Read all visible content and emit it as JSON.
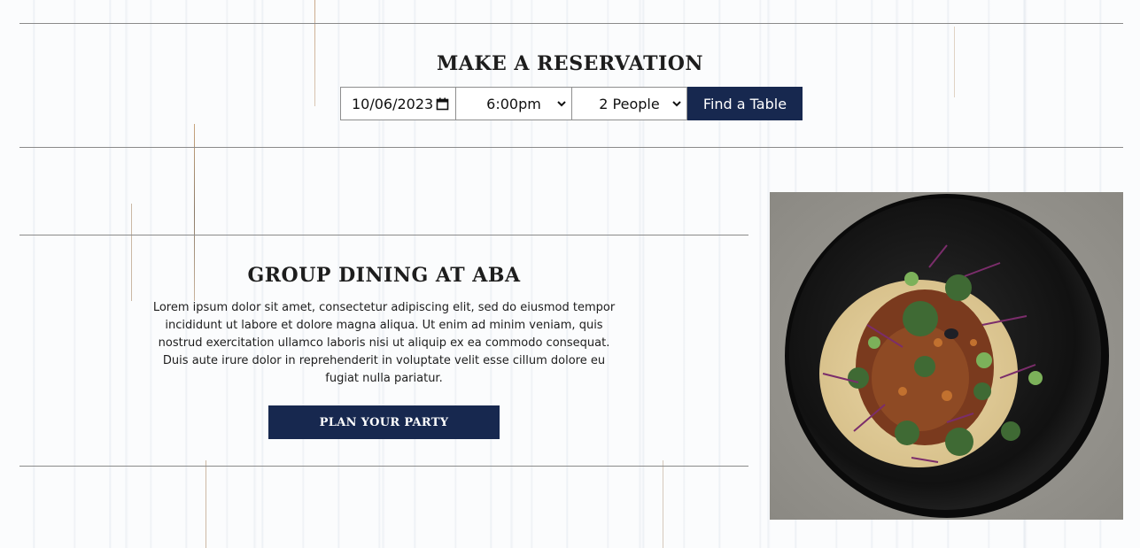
{
  "reservation": {
    "title": "MAKE A RESERVATION",
    "date_value": "10/06/2023",
    "time_value": "6:00pm",
    "party_value": "2 People",
    "find_label": "Find a Table"
  },
  "group_dining": {
    "title": "GROUP DINING AT ABA",
    "body": "Lorem ipsum dolor sit amet, consectetur adipiscing elit, sed do eiusmod tempor incididunt ut labore et dolore magna aliqua. Ut enim ad minim veniam, quis nostrud exercitation ullamco laboris nisi ut aliquip ex ea commodo consequat. Duis aute irure dolor in reprehenderit in voluptate velit esse cillum dolore eu fugiat nulla pariatur.",
    "cta_label": "PLAN YOUR PARTY"
  },
  "icons": {
    "calendar": "calendar-icon",
    "chevron": "chevron-down-icon"
  },
  "colors": {
    "navy": "#17284f",
    "divider": "#8a8a8a",
    "text": "#1d1d1d"
  }
}
